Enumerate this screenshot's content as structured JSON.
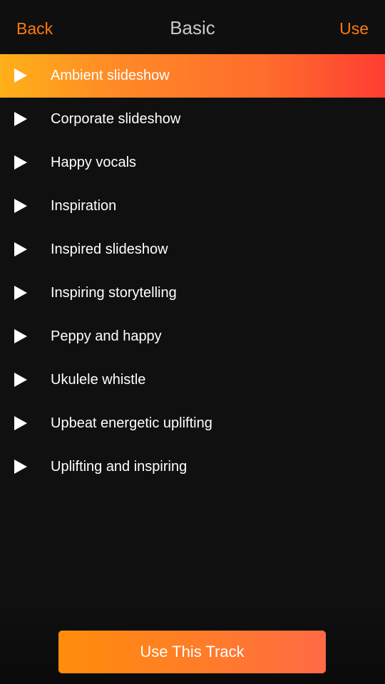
{
  "header": {
    "back_label": "Back",
    "title": "Basic",
    "use_label": "Use"
  },
  "tracks": [
    {
      "label": "Ambient slideshow",
      "selected": true
    },
    {
      "label": "Corporate slideshow",
      "selected": false
    },
    {
      "label": "Happy vocals",
      "selected": false
    },
    {
      "label": "Inspiration",
      "selected": false
    },
    {
      "label": "Inspired slideshow",
      "selected": false
    },
    {
      "label": "Inspiring storytelling",
      "selected": false
    },
    {
      "label": "Peppy and happy",
      "selected": false
    },
    {
      "label": "Ukulele whistle",
      "selected": false
    },
    {
      "label": "Upbeat energetic uplifting",
      "selected": false
    },
    {
      "label": "Uplifting and inspiring",
      "selected": false
    }
  ],
  "icons": {
    "track": "play-icon"
  },
  "footer": {
    "button_label": "Use This Track"
  },
  "colors": {
    "accent": "#ff7a0d",
    "background": "#101010",
    "selected_gradient_start": "#ffb019",
    "selected_gradient_end": "#ff3d33",
    "text": "#ffffff",
    "title": "#c9c9c9"
  }
}
